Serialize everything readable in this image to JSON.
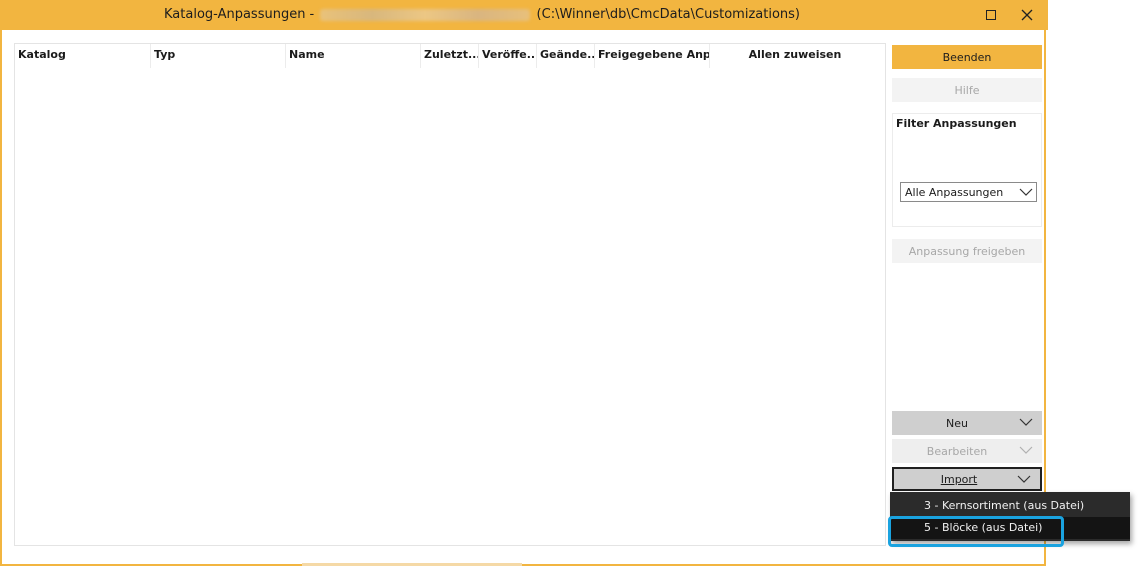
{
  "window": {
    "title_prefix": "Katalog-Anpassungen -",
    "title_suffix": "(C:\\Winner\\db\\CmcData\\Customizations)"
  },
  "table": {
    "columns": [
      "Katalog",
      "Typ",
      "Name",
      "Zuletzt...",
      "Veröffe...",
      "Geände...",
      "Freigegebene Anp...",
      "Allen zuweisen"
    ]
  },
  "sidebar": {
    "beenden": "Beenden",
    "hilfe": "Hilfe",
    "filter_title": "Filter Anpassungen",
    "filter_value": "Alle Anpassungen",
    "freigeben": "Anpassung freigeben",
    "neu": "Neu",
    "bearbeiten": "Bearbeiten",
    "import": "Import"
  },
  "import_menu": {
    "items": [
      "3 - Kernsortiment (aus Datei)",
      "5 - Blöcke (aus Datei)"
    ]
  },
  "colors": {
    "accent": "#f2b540",
    "highlight": "#1aa3e0",
    "menu_bg": "#2b2b2b"
  }
}
